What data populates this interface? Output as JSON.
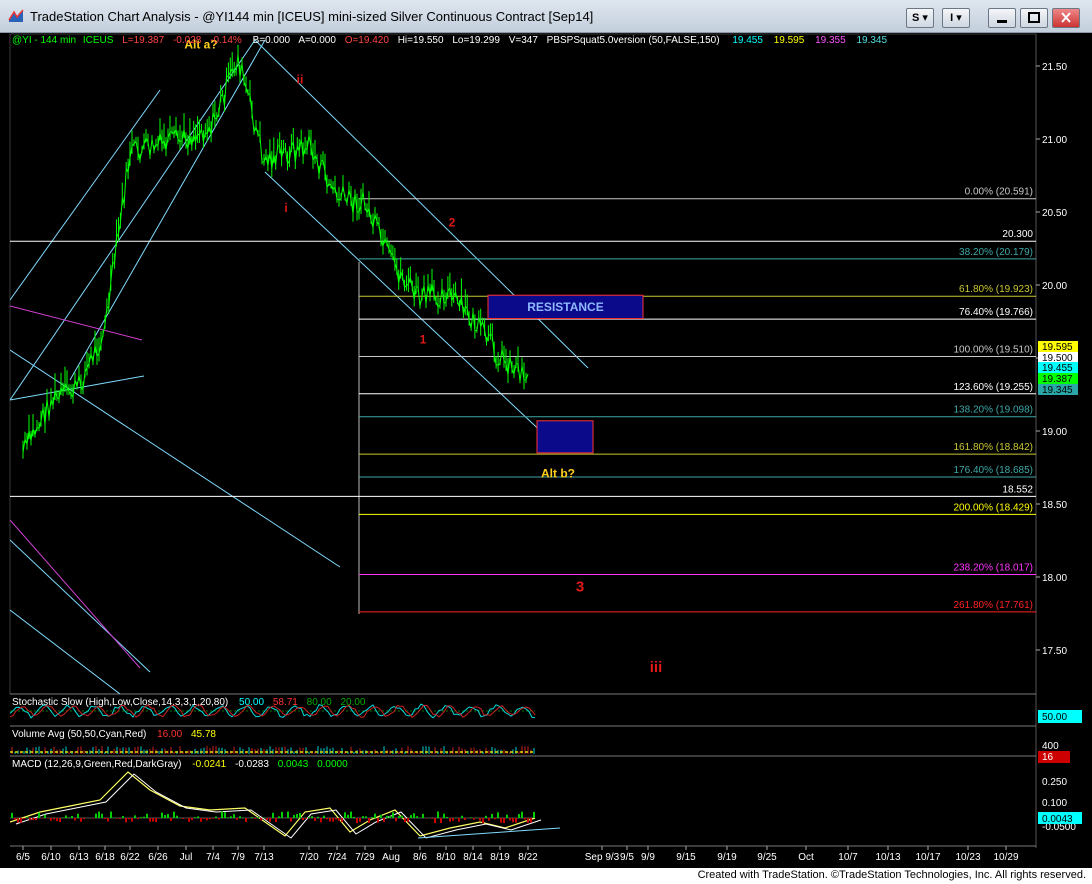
{
  "window": {
    "title": "TradeStation Chart Analysis - @YI144 min [ICEUS] mini-sized Silver Continuous Contract [Sep14]",
    "btn_s": "S ▾",
    "btn_i": "I ▾"
  },
  "header": {
    "symbol": "@YI - 144 min",
    "exchange": "ICEUS",
    "last": "L=19.387",
    "change": "-0.028",
    "pct": "-0.14%",
    "bid": "B=0.000",
    "ask": "A=0.000",
    "open": "O=19.420",
    "high": "Hi=19.550",
    "low": "Lo=19.299",
    "volume": "V=347",
    "study": "PBSPSquat5.0version (50,FALSE,150)",
    "study_v1": "19.455",
    "study_v2": "19.595",
    "study_v3": "19.355",
    "study_v4": "19.345"
  },
  "colors": {
    "background": "#000000",
    "price": "#00ff00",
    "channel": "#7fdcff",
    "fib_cyan": "#3fa8a8",
    "fib_yellow": "#c8c832",
    "fib_white": "#ffffff",
    "fib_magenta": "#ff33ff",
    "fib_red": "#ff2222",
    "wave_label": "#e01818",
    "alt_label": "#ffd21e",
    "zone_fill": "#0a0a8a"
  },
  "chart_data": {
    "type": "line",
    "title": "",
    "xlabel": "",
    "ylabel": "",
    "ylim": [
      17.3,
      21.7
    ],
    "x_ticks": [
      "6/5",
      "6/10",
      "6/13",
      "6/18",
      "6/22",
      "6/26",
      "Jul",
      "7/4",
      "7/9",
      "7/13",
      "7/20",
      "7/24",
      "7/29",
      "Aug",
      "8/6",
      "8/10",
      "8/14",
      "8/19",
      "8/22",
      "Sep 9/3",
      "9/5",
      "9/9",
      "9/15",
      "9/19",
      "9/25",
      "Oct",
      "10/7",
      "10/13",
      "10/17",
      "10/23",
      "10/29"
    ],
    "y_ticks": [
      17.5,
      18.0,
      18.5,
      19.0,
      19.5,
      20.0,
      20.5,
      21.0,
      21.5
    ],
    "series": [
      {
        "x": [
          "6/5",
          "6/10",
          "6/13",
          "6/18",
          "6/22",
          "6/26",
          "Jul",
          "7/4",
          "7/9",
          "7/13",
          "7/20",
          "7/24",
          "7/29",
          "Aug",
          "8/6",
          "8/10",
          "8/14",
          "8/19",
          "8/22"
        ],
        "values": [
          18.85,
          19.2,
          19.3,
          19.7,
          20.9,
          20.95,
          21.0,
          21.1,
          21.55,
          20.85,
          20.95,
          20.6,
          20.55,
          20.15,
          19.9,
          19.95,
          19.75,
          19.5,
          19.39
        ]
      }
    ],
    "fib_levels": [
      {
        "label": "0.00% (20.591)",
        "value": 20.591,
        "color": "#c8c8c8"
      },
      {
        "label": "20.300",
        "value": 20.3,
        "color": "#ffffff"
      },
      {
        "label": "38.20% (20.179)",
        "value": 20.179,
        "color": "#3fa8a8"
      },
      {
        "label": "61.80% (19.923)",
        "value": 19.923,
        "color": "#c8c832"
      },
      {
        "label": "76.40% (19.766)",
        "value": 19.766,
        "color": "#ffffff"
      },
      {
        "label": "100.00% (19.510)",
        "value": 19.51,
        "color": "#c8c8c8"
      },
      {
        "label": "123.60% (19.255)",
        "value": 19.255,
        "color": "#ffffff"
      },
      {
        "label": "138.20% (19.098)",
        "value": 19.098,
        "color": "#3fa8a8"
      },
      {
        "label": "161.80% (18.842)",
        "value": 18.842,
        "color": "#c8c832"
      },
      {
        "label": "176.40% (18.685)",
        "value": 18.685,
        "color": "#3fa8a8"
      },
      {
        "label": "18.552",
        "value": 18.552,
        "color": "#ffffff"
      },
      {
        "label": "200.00% (18.429)",
        "value": 18.429,
        "color": "#ffff00"
      },
      {
        "label": "238.20% (18.017)",
        "value": 18.017,
        "color": "#ff33ff"
      },
      {
        "label": "261.80% (17.761)",
        "value": 17.761,
        "color": "#ff2222"
      }
    ],
    "wave_labels": [
      {
        "text": "Alt a?",
        "x": "7/4",
        "y": 21.62,
        "color": "#ffd21e"
      },
      {
        "text": "ii",
        "x": "7/13",
        "y": 21.38,
        "color": "#e01818"
      },
      {
        "text": "i",
        "x": "7/13",
        "y": 20.5,
        "color": "#e01818"
      },
      {
        "text": "2",
        "x": "8/10",
        "y": 20.4,
        "color": "#e01818"
      },
      {
        "text": "1",
        "x": "8/6",
        "y": 19.6,
        "color": "#e01818"
      },
      {
        "text": "Alt b?",
        "x": "8/22",
        "y": 18.68,
        "color": "#ffd21e"
      },
      {
        "text": "3",
        "x": "Sep 9/3",
        "y": 17.9,
        "color": "#e01818"
      },
      {
        "text": "iii",
        "x": "9/15",
        "y": 17.35,
        "color": "#e01818"
      }
    ],
    "zones": [
      {
        "label": "RESISTANCE",
        "from": 19.77,
        "to": 19.93
      },
      {
        "label": "",
        "from": 18.85,
        "to": 19.07
      }
    ],
    "price_markers": [
      {
        "text": "19.595",
        "bg": "#ffff00",
        "fg": "#000000"
      },
      {
        "text": "19.500",
        "bg": "#ffffff",
        "fg": "#000000"
      },
      {
        "text": "19.455",
        "bg": "#00ffff",
        "fg": "#000000"
      },
      {
        "text": "19.387",
        "bg": "#00ff00",
        "fg": "#000000"
      },
      {
        "text": "19.345",
        "bg": "#2aa6a6",
        "fg": "#000000"
      }
    ]
  },
  "indicators": {
    "stoch": {
      "label": "Stochastic Slow (High,Low,Close,14,3,3,1,20,80)",
      "v1": "50.00",
      "v2": "58.71",
      "v3": "80.00",
      "v4": "20.00",
      "marker": "50.00"
    },
    "volume": {
      "label": "Volume Avg (50,50,Cyan,Red)",
      "v1": "16.00",
      "v2": "45.78",
      "tick": "400",
      "marker": "16"
    },
    "macd": {
      "label": "MACD (12,26,9,Green,Red,DarkGray)",
      "v1": "-0.0241",
      "v2": "-0.0283",
      "v3": "0.0043",
      "v4": "0.0000",
      "ticks": [
        "0.250",
        "0.100",
        "-0.0500"
      ],
      "marker": "0.0043"
    }
  },
  "footer": {
    "text": "Created with TradeStation. ©TradeStation Technologies, Inc. All rights reserved."
  }
}
